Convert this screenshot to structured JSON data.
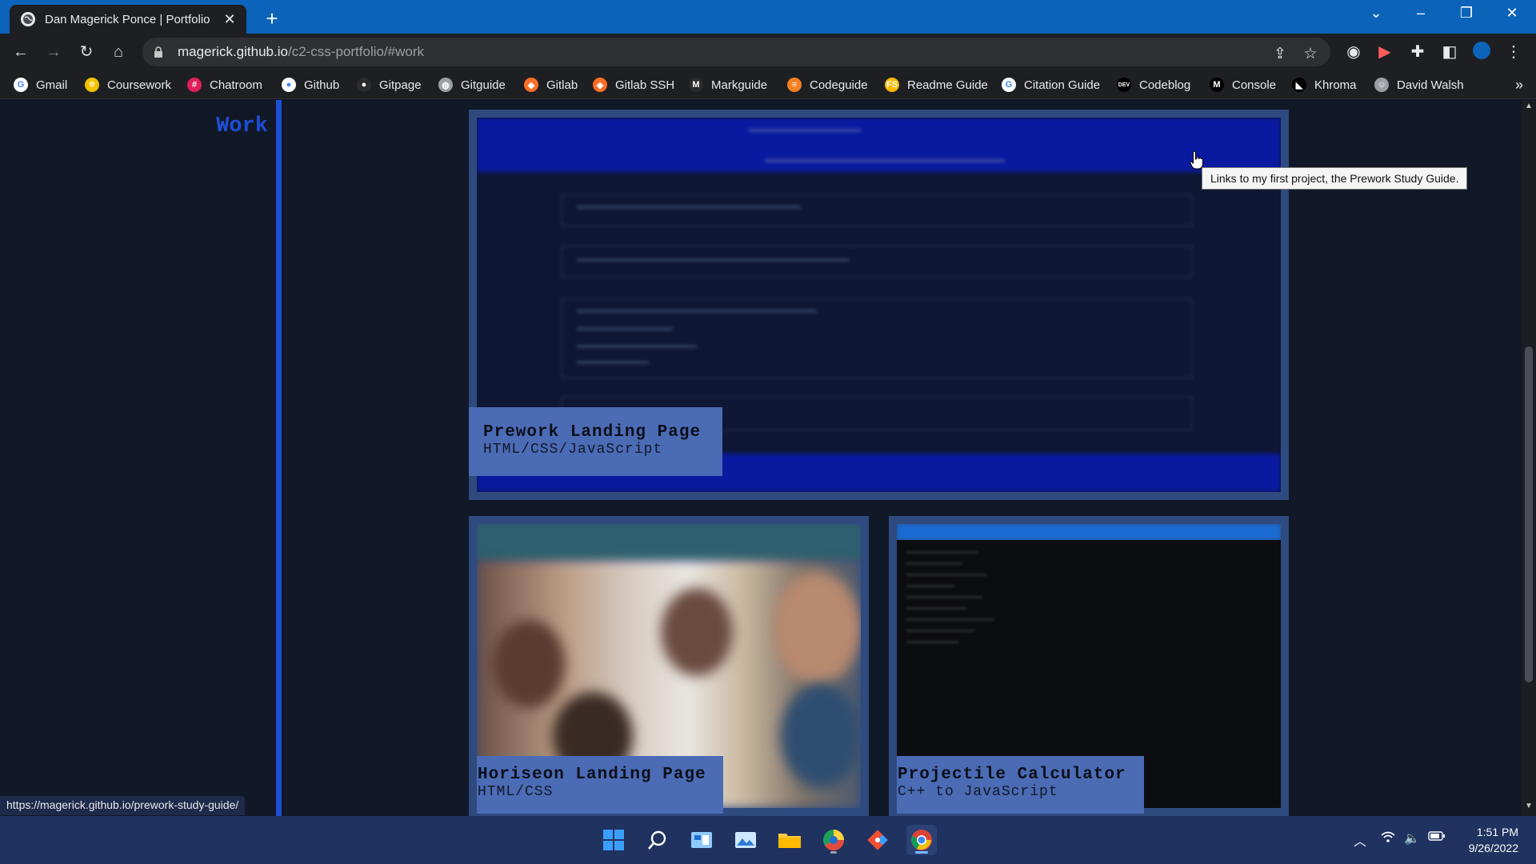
{
  "browser": {
    "tab_title": "Dan Magerick Ponce | Portfolio",
    "tab_close": "✕",
    "new_tab": "+",
    "url_host": "magerick.github.io",
    "url_path": "/c2-css-portfolio/#work",
    "status_url": "https://magerick.github.io/prework-study-guide/"
  },
  "bookmarks": [
    {
      "label": "Gmail",
      "icon": "google-icon",
      "color": "#ffffff",
      "glyph": "G"
    },
    {
      "label": "Coursework",
      "icon": "coursework-icon",
      "color": "#f2c100",
      "glyph": "⌾"
    },
    {
      "label": "Chatroom",
      "icon": "slack-icon",
      "color": "#e01e5a",
      "glyph": "#"
    },
    {
      "label": "Github",
      "icon": "github-icon",
      "color": "#ffffff",
      "glyph": "●"
    },
    {
      "label": "Gitpage",
      "icon": "github-icon",
      "color": "#2b2b2b",
      "glyph": "●"
    },
    {
      "label": "Gitguide",
      "icon": "globe-icon",
      "color": "#9aa0a6",
      "glyph": "◍"
    },
    {
      "label": "Gitlab",
      "icon": "gitlab-icon",
      "color": "#fc6d26",
      "glyph": "◆"
    },
    {
      "label": "Gitlab SSH",
      "icon": "gitlab-icon",
      "color": "#fc6d26",
      "glyph": "◆"
    },
    {
      "label": "Markguide",
      "icon": "markdown-icon",
      "color": "#2b2b2b",
      "glyph": "M"
    },
    {
      "label": "Codeguide",
      "icon": "stackoverflow-icon",
      "color": "#f48024",
      "glyph": "≡"
    },
    {
      "label": "Readme Guide",
      "icon": "readme-icon",
      "color": "#f6b900",
      "glyph": "FS"
    },
    {
      "label": "Citation Guide",
      "icon": "google-icon",
      "color": "#ffffff",
      "glyph": "G"
    },
    {
      "label": "Codeblog",
      "icon": "dev-icon",
      "color": "#000000",
      "glyph": "DEV"
    },
    {
      "label": "Console",
      "icon": "console-icon",
      "color": "#000000",
      "glyph": "M"
    },
    {
      "label": "Khroma",
      "icon": "khroma-icon",
      "color": "#000000",
      "glyph": "◣"
    },
    {
      "label": "David Walsh",
      "icon": "davidwalsh-icon",
      "color": "#9aa0a6",
      "glyph": "☺"
    }
  ],
  "bookmarks_overflow": "»",
  "sidebar": {
    "heading": "Work"
  },
  "projects": [
    {
      "name": "Prework Landing Page",
      "tech": "HTML/CSS/JavaScript"
    },
    {
      "name": "Horiseon Landing Page",
      "tech": "HTML/CSS"
    },
    {
      "name": "Projectile Calculator",
      "tech": "C++ to JavaScript"
    }
  ],
  "tooltip": "Links to my first project, the Prework Study Guide.",
  "taskbar": {
    "time": "1:51 PM",
    "date": "9/26/2022"
  },
  "colors": {
    "accent": "#1d4ed8",
    "card_border": "#2f4a7f",
    "label_bg": "#4b6bb5",
    "page_bg": "#111827"
  }
}
